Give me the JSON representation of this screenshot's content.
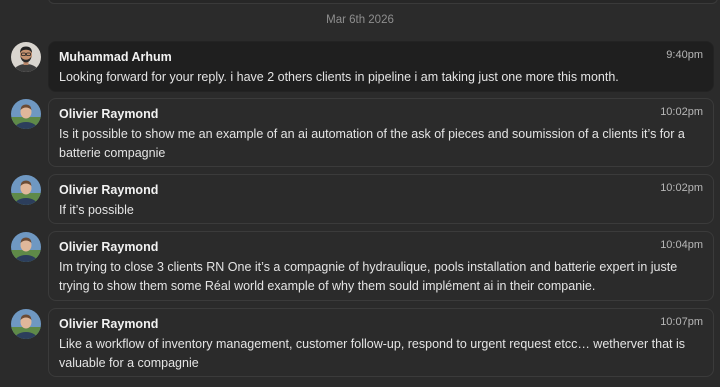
{
  "date_separator": "Mar 6th 2026",
  "messages": [
    {
      "sender": "Muhammad Arhum",
      "time": "9:40pm",
      "text": "Looking forward for your reply. i have 2 others clients in pipeline i am taking just one more this month.",
      "avatar": "avatar-muhammad-arhum"
    },
    {
      "sender": "Olivier Raymond",
      "time": "10:02pm",
      "text": "Is it possible to show me an example of an ai automation of the ask of pieces and soumission of a clients it’s for a batterie compagnie",
      "avatar": "avatar-olivier-raymond"
    },
    {
      "sender": "Olivier Raymond",
      "time": "10:02pm",
      "text": "If it’s possible",
      "avatar": "avatar-olivier-raymond"
    },
    {
      "sender": "Olivier Raymond",
      "time": "10:04pm",
      "text": "Im trying to close 3 clients RN One it’s a compagnie of hydraulique, pools installation and batterie expert in juste trying to show them some Réal world example of why them sould implément ai in their companie.",
      "avatar": "avatar-olivier-raymond"
    },
    {
      "sender": "Olivier Raymond",
      "time": "10:07pm",
      "text": "Like a workflow of inventory management, customer follow-up, respond to urgent request etcc… wetherver that is valuable for a compagnie",
      "avatar": "avatar-olivier-raymond"
    }
  ]
}
